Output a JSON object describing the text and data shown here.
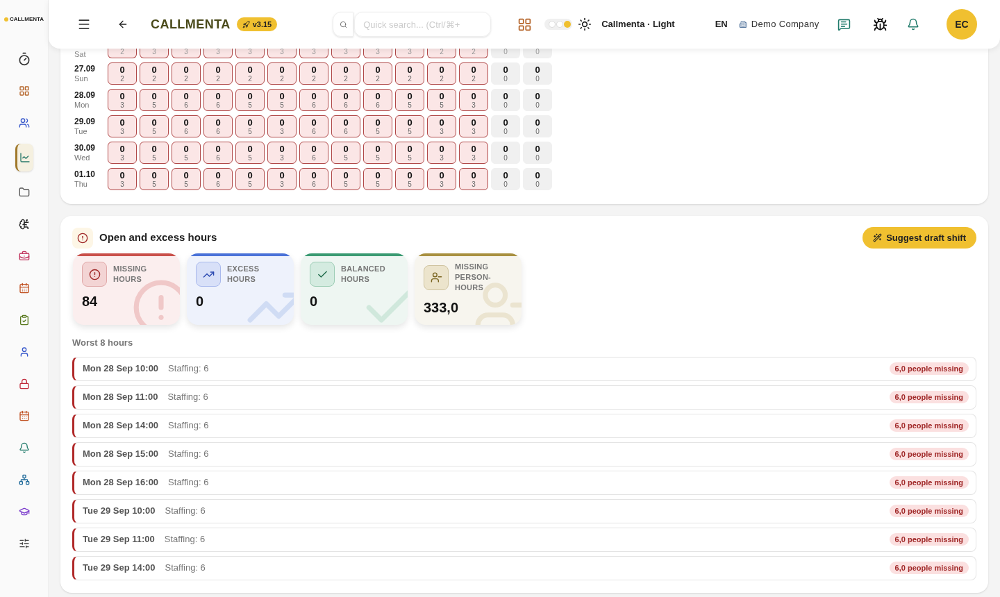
{
  "header": {
    "brand": "CALLMENTA",
    "version": "v3.15",
    "search_placeholder": "Quick search... (Ctrl/⌘+",
    "theme_label": "Callmenta · Light",
    "language": "EN",
    "company": "Demo Company",
    "avatar": "EC"
  },
  "sidebar": {
    "logo": "CALLMENTA",
    "items": [
      {
        "selected": false
      },
      {
        "selected": false
      },
      {
        "selected": false
      },
      {
        "selected": true
      },
      {
        "selected": false
      },
      {
        "selected": false
      },
      {
        "selected": false
      },
      {
        "selected": false
      },
      {
        "selected": false
      },
      {
        "selected": false
      },
      {
        "selected": false
      },
      {
        "selected": false
      },
      {
        "selected": false
      },
      {
        "selected": false
      },
      {
        "selected": false
      },
      {
        "selected": false
      }
    ]
  },
  "theme_toggle": {
    "options": [
      {
        "selected": false
      },
      {
        "selected": false
      },
      {
        "selected": true
      }
    ]
  },
  "coverage_grid": {
    "partial_row": {
      "day": "Sat",
      "cells": [
        {
          "value": "2",
          "kind": "under"
        },
        {
          "value": "3",
          "kind": "under"
        },
        {
          "value": "3",
          "kind": "under"
        },
        {
          "value": "3",
          "kind": "under"
        },
        {
          "value": "3",
          "kind": "under"
        },
        {
          "value": "3",
          "kind": "under"
        },
        {
          "value": "3",
          "kind": "under"
        },
        {
          "value": "3",
          "kind": "under"
        },
        {
          "value": "3",
          "kind": "under"
        },
        {
          "value": "3",
          "kind": "under"
        },
        {
          "value": "2",
          "kind": "under"
        },
        {
          "value": "2",
          "kind": "under"
        },
        {
          "value": "0",
          "kind": "closed"
        },
        {
          "value": "0",
          "kind": "closed"
        }
      ]
    },
    "rows": [
      {
        "date": "27.09",
        "day": "Sun",
        "cells": [
          {
            "staffed": "0",
            "required": "2",
            "kind": "under"
          },
          {
            "staffed": "0",
            "required": "2",
            "kind": "under"
          },
          {
            "staffed": "0",
            "required": "2",
            "kind": "under"
          },
          {
            "staffed": "0",
            "required": "2",
            "kind": "under"
          },
          {
            "staffed": "0",
            "required": "2",
            "kind": "under"
          },
          {
            "staffed": "0",
            "required": "2",
            "kind": "under"
          },
          {
            "staffed": "0",
            "required": "2",
            "kind": "under"
          },
          {
            "staffed": "0",
            "required": "2",
            "kind": "under"
          },
          {
            "staffed": "0",
            "required": "2",
            "kind": "under"
          },
          {
            "staffed": "0",
            "required": "2",
            "kind": "under"
          },
          {
            "staffed": "0",
            "required": "2",
            "kind": "under"
          },
          {
            "staffed": "0",
            "required": "2",
            "kind": "under"
          },
          {
            "staffed": "0",
            "required": "0",
            "kind": "closed"
          },
          {
            "staffed": "0",
            "required": "0",
            "kind": "closed"
          }
        ]
      },
      {
        "date": "28.09",
        "day": "Mon",
        "cells": [
          {
            "staffed": "0",
            "required": "3",
            "kind": "under"
          },
          {
            "staffed": "0",
            "required": "5",
            "kind": "under"
          },
          {
            "staffed": "0",
            "required": "6",
            "kind": "under"
          },
          {
            "staffed": "0",
            "required": "6",
            "kind": "under"
          },
          {
            "staffed": "0",
            "required": "5",
            "kind": "under"
          },
          {
            "staffed": "0",
            "required": "5",
            "kind": "under"
          },
          {
            "staffed": "0",
            "required": "6",
            "kind": "under"
          },
          {
            "staffed": "0",
            "required": "6",
            "kind": "under"
          },
          {
            "staffed": "0",
            "required": "6",
            "kind": "under"
          },
          {
            "staffed": "0",
            "required": "5",
            "kind": "under"
          },
          {
            "staffed": "0",
            "required": "5",
            "kind": "under"
          },
          {
            "staffed": "0",
            "required": "3",
            "kind": "under"
          },
          {
            "staffed": "0",
            "required": "0",
            "kind": "closed"
          },
          {
            "staffed": "0",
            "required": "0",
            "kind": "closed"
          }
        ]
      },
      {
        "date": "29.09",
        "day": "Tue",
        "cells": [
          {
            "staffed": "0",
            "required": "3",
            "kind": "under"
          },
          {
            "staffed": "0",
            "required": "5",
            "kind": "under"
          },
          {
            "staffed": "0",
            "required": "6",
            "kind": "under"
          },
          {
            "staffed": "0",
            "required": "6",
            "kind": "under"
          },
          {
            "staffed": "0",
            "required": "5",
            "kind": "under"
          },
          {
            "staffed": "0",
            "required": "3",
            "kind": "under"
          },
          {
            "staffed": "0",
            "required": "6",
            "kind": "under"
          },
          {
            "staffed": "0",
            "required": "6",
            "kind": "under"
          },
          {
            "staffed": "0",
            "required": "5",
            "kind": "under"
          },
          {
            "staffed": "0",
            "required": "5",
            "kind": "under"
          },
          {
            "staffed": "0",
            "required": "3",
            "kind": "under"
          },
          {
            "staffed": "0",
            "required": "3",
            "kind": "under"
          },
          {
            "staffed": "0",
            "required": "0",
            "kind": "closed"
          },
          {
            "staffed": "0",
            "required": "0",
            "kind": "closed"
          }
        ]
      },
      {
        "date": "30.09",
        "day": "Wed",
        "cells": [
          {
            "staffed": "0",
            "required": "3",
            "kind": "under"
          },
          {
            "staffed": "0",
            "required": "5",
            "kind": "under"
          },
          {
            "staffed": "0",
            "required": "5",
            "kind": "under"
          },
          {
            "staffed": "0",
            "required": "6",
            "kind": "under"
          },
          {
            "staffed": "0",
            "required": "5",
            "kind": "under"
          },
          {
            "staffed": "0",
            "required": "3",
            "kind": "under"
          },
          {
            "staffed": "0",
            "required": "6",
            "kind": "under"
          },
          {
            "staffed": "0",
            "required": "5",
            "kind": "under"
          },
          {
            "staffed": "0",
            "required": "5",
            "kind": "under"
          },
          {
            "staffed": "0",
            "required": "5",
            "kind": "under"
          },
          {
            "staffed": "0",
            "required": "3",
            "kind": "under"
          },
          {
            "staffed": "0",
            "required": "3",
            "kind": "under"
          },
          {
            "staffed": "0",
            "required": "0",
            "kind": "closed"
          },
          {
            "staffed": "0",
            "required": "0",
            "kind": "closed"
          }
        ]
      },
      {
        "date": "01.10",
        "day": "Thu",
        "cells": [
          {
            "staffed": "0",
            "required": "3",
            "kind": "under"
          },
          {
            "staffed": "0",
            "required": "5",
            "kind": "under"
          },
          {
            "staffed": "0",
            "required": "5",
            "kind": "under"
          },
          {
            "staffed": "0",
            "required": "6",
            "kind": "under"
          },
          {
            "staffed": "0",
            "required": "5",
            "kind": "under"
          },
          {
            "staffed": "0",
            "required": "3",
            "kind": "under"
          },
          {
            "staffed": "0",
            "required": "6",
            "kind": "under"
          },
          {
            "staffed": "0",
            "required": "5",
            "kind": "under"
          },
          {
            "staffed": "0",
            "required": "5",
            "kind": "under"
          },
          {
            "staffed": "0",
            "required": "5",
            "kind": "under"
          },
          {
            "staffed": "0",
            "required": "3",
            "kind": "under"
          },
          {
            "staffed": "0",
            "required": "3",
            "kind": "under"
          },
          {
            "staffed": "0",
            "required": "0",
            "kind": "closed"
          },
          {
            "staffed": "0",
            "required": "0",
            "kind": "closed"
          }
        ]
      }
    ]
  },
  "open_hours": {
    "title": "Open and excess hours",
    "action": "Suggest draft shift",
    "stats": [
      {
        "kind": "missing",
        "label": "MISSING HOURS",
        "value": "84"
      },
      {
        "kind": "excess",
        "label": "EXCESS HOURS",
        "value": "0"
      },
      {
        "kind": "balanced",
        "label": "BALANCED HOURS",
        "value": "0"
      },
      {
        "kind": "person",
        "label": "MISSING PERSON-HOURS",
        "value": "333,0"
      }
    ],
    "worst_title": "Worst 8 hours",
    "worst": [
      {
        "time": "Mon 28 Sep 10:00",
        "staffing": "Staffing: 6",
        "badge": "6,0 people missing"
      },
      {
        "time": "Mon 28 Sep 11:00",
        "staffing": "Staffing: 6",
        "badge": "6,0 people missing"
      },
      {
        "time": "Mon 28 Sep 14:00",
        "staffing": "Staffing: 6",
        "badge": "6,0 people missing"
      },
      {
        "time": "Mon 28 Sep 15:00",
        "staffing": "Staffing: 6",
        "badge": "6,0 people missing"
      },
      {
        "time": "Mon 28 Sep 16:00",
        "staffing": "Staffing: 6",
        "badge": "6,0 people missing"
      },
      {
        "time": "Tue 29 Sep 10:00",
        "staffing": "Staffing: 6",
        "badge": "6,0 people missing"
      },
      {
        "time": "Tue 29 Sep 11:00",
        "staffing": "Staffing: 6",
        "badge": "6,0 people missing"
      },
      {
        "time": "Tue 29 Sep 14:00",
        "staffing": "Staffing: 6",
        "badge": "6,0 people missing"
      }
    ]
  }
}
